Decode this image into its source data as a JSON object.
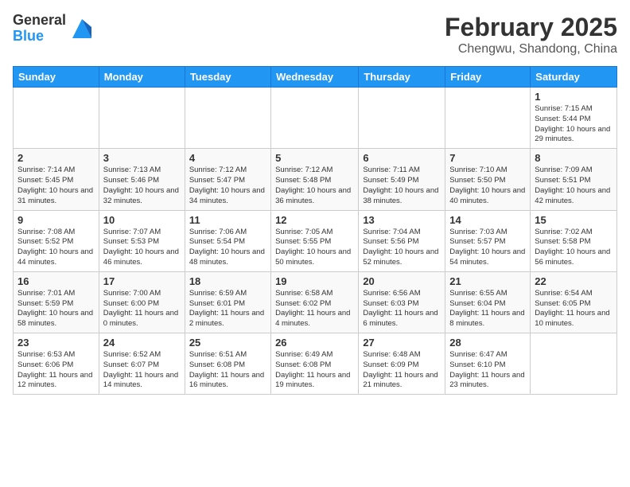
{
  "header": {
    "logo_general": "General",
    "logo_blue": "Blue",
    "month_year": "February 2025",
    "location": "Chengwu, Shandong, China"
  },
  "weekdays": [
    "Sunday",
    "Monday",
    "Tuesday",
    "Wednesday",
    "Thursday",
    "Friday",
    "Saturday"
  ],
  "weeks": [
    [
      {
        "day": "",
        "info": ""
      },
      {
        "day": "",
        "info": ""
      },
      {
        "day": "",
        "info": ""
      },
      {
        "day": "",
        "info": ""
      },
      {
        "day": "",
        "info": ""
      },
      {
        "day": "",
        "info": ""
      },
      {
        "day": "1",
        "info": "Sunrise: 7:15 AM\nSunset: 5:44 PM\nDaylight: 10 hours and 29 minutes."
      }
    ],
    [
      {
        "day": "2",
        "info": "Sunrise: 7:14 AM\nSunset: 5:45 PM\nDaylight: 10 hours and 31 minutes."
      },
      {
        "day": "3",
        "info": "Sunrise: 7:13 AM\nSunset: 5:46 PM\nDaylight: 10 hours and 32 minutes."
      },
      {
        "day": "4",
        "info": "Sunrise: 7:12 AM\nSunset: 5:47 PM\nDaylight: 10 hours and 34 minutes."
      },
      {
        "day": "5",
        "info": "Sunrise: 7:12 AM\nSunset: 5:48 PM\nDaylight: 10 hours and 36 minutes."
      },
      {
        "day": "6",
        "info": "Sunrise: 7:11 AM\nSunset: 5:49 PM\nDaylight: 10 hours and 38 minutes."
      },
      {
        "day": "7",
        "info": "Sunrise: 7:10 AM\nSunset: 5:50 PM\nDaylight: 10 hours and 40 minutes."
      },
      {
        "day": "8",
        "info": "Sunrise: 7:09 AM\nSunset: 5:51 PM\nDaylight: 10 hours and 42 minutes."
      }
    ],
    [
      {
        "day": "9",
        "info": "Sunrise: 7:08 AM\nSunset: 5:52 PM\nDaylight: 10 hours and 44 minutes."
      },
      {
        "day": "10",
        "info": "Sunrise: 7:07 AM\nSunset: 5:53 PM\nDaylight: 10 hours and 46 minutes."
      },
      {
        "day": "11",
        "info": "Sunrise: 7:06 AM\nSunset: 5:54 PM\nDaylight: 10 hours and 48 minutes."
      },
      {
        "day": "12",
        "info": "Sunrise: 7:05 AM\nSunset: 5:55 PM\nDaylight: 10 hours and 50 minutes."
      },
      {
        "day": "13",
        "info": "Sunrise: 7:04 AM\nSunset: 5:56 PM\nDaylight: 10 hours and 52 minutes."
      },
      {
        "day": "14",
        "info": "Sunrise: 7:03 AM\nSunset: 5:57 PM\nDaylight: 10 hours and 54 minutes."
      },
      {
        "day": "15",
        "info": "Sunrise: 7:02 AM\nSunset: 5:58 PM\nDaylight: 10 hours and 56 minutes."
      }
    ],
    [
      {
        "day": "16",
        "info": "Sunrise: 7:01 AM\nSunset: 5:59 PM\nDaylight: 10 hours and 58 minutes."
      },
      {
        "day": "17",
        "info": "Sunrise: 7:00 AM\nSunset: 6:00 PM\nDaylight: 11 hours and 0 minutes."
      },
      {
        "day": "18",
        "info": "Sunrise: 6:59 AM\nSunset: 6:01 PM\nDaylight: 11 hours and 2 minutes."
      },
      {
        "day": "19",
        "info": "Sunrise: 6:58 AM\nSunset: 6:02 PM\nDaylight: 11 hours and 4 minutes."
      },
      {
        "day": "20",
        "info": "Sunrise: 6:56 AM\nSunset: 6:03 PM\nDaylight: 11 hours and 6 minutes."
      },
      {
        "day": "21",
        "info": "Sunrise: 6:55 AM\nSunset: 6:04 PM\nDaylight: 11 hours and 8 minutes."
      },
      {
        "day": "22",
        "info": "Sunrise: 6:54 AM\nSunset: 6:05 PM\nDaylight: 11 hours and 10 minutes."
      }
    ],
    [
      {
        "day": "23",
        "info": "Sunrise: 6:53 AM\nSunset: 6:06 PM\nDaylight: 11 hours and 12 minutes."
      },
      {
        "day": "24",
        "info": "Sunrise: 6:52 AM\nSunset: 6:07 PM\nDaylight: 11 hours and 14 minutes."
      },
      {
        "day": "25",
        "info": "Sunrise: 6:51 AM\nSunset: 6:08 PM\nDaylight: 11 hours and 16 minutes."
      },
      {
        "day": "26",
        "info": "Sunrise: 6:49 AM\nSunset: 6:08 PM\nDaylight: 11 hours and 19 minutes."
      },
      {
        "day": "27",
        "info": "Sunrise: 6:48 AM\nSunset: 6:09 PM\nDaylight: 11 hours and 21 minutes."
      },
      {
        "day": "28",
        "info": "Sunrise: 6:47 AM\nSunset: 6:10 PM\nDaylight: 11 hours and 23 minutes."
      },
      {
        "day": "",
        "info": ""
      }
    ]
  ]
}
